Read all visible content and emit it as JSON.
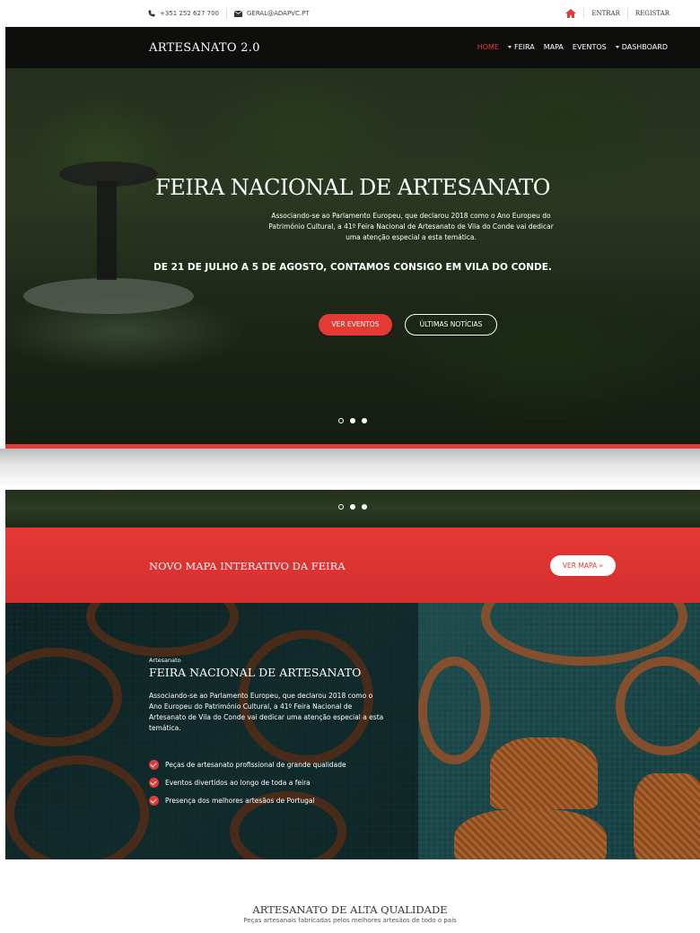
{
  "topbar": {
    "phone": "+351 252 627 700",
    "email": "GERAL@ADAPVC.PT",
    "login": "ENTRAR",
    "register": "REGISTAR",
    "home_icon_color": "#e53935"
  },
  "navbar": {
    "brand": "ARTESANATO 2.0",
    "items": [
      {
        "label": "HOME",
        "active": true,
        "dropdown": false
      },
      {
        "label": "FEIRA",
        "active": false,
        "dropdown": true
      },
      {
        "label": "MAPA",
        "active": false,
        "dropdown": false
      },
      {
        "label": "EVENTOS",
        "active": false,
        "dropdown": false
      },
      {
        "label": "DASHBOARD",
        "active": false,
        "dropdown": true
      }
    ]
  },
  "hero": {
    "title": "FEIRA NACIONAL DE ARTESANATO",
    "description": "Associando-se ao Parlamento Europeu, que declarou 2018 como o Ano Europeu do Património Cultural, a 41º Feira Nacional de Artesanato de Vila do Conde vai dedicar uma atenção especial a esta temática.",
    "dates": "DE 21 DE JULHO A 5 DE AGOSTO, CONTAMOS CONSIGO EM VILA DO CONDE.",
    "primary_button": "VER EVENTOS",
    "secondary_button": "ÚLTIMAS NOTÍCIAS",
    "slides": 3,
    "active_slide": 1
  },
  "cta": {
    "title": "NOVO MAPA INTERATIVO DA FEIRA",
    "button": "VER MAPA »"
  },
  "feature": {
    "kicker": "Artesanato",
    "title": "FEIRA NACIONAL DE ARTESANATO",
    "text": "Associando-se ao Parlamento Europeu, que declarou 2018 como o Ano Europeu do Património Cultural, a 41º Feira Nacional de Artesanato de Vila do Conde vai dedicar uma atenção especial a esta temática.",
    "bullets": [
      "Peças de artesanato profissional de grande qualidade",
      "Eventos divertidos ao longo de toda a feira",
      "Presença dos melhores artesãos de Portugal"
    ]
  },
  "quality": {
    "title": "ARTESANATO DE ALTA QUALIDADE",
    "subtitle": "Peças artesanais fabricadas pelos melhores artesãos de todo o país"
  },
  "colors": {
    "accent": "#e53935",
    "navbar_bg": "#0c0c0c"
  }
}
